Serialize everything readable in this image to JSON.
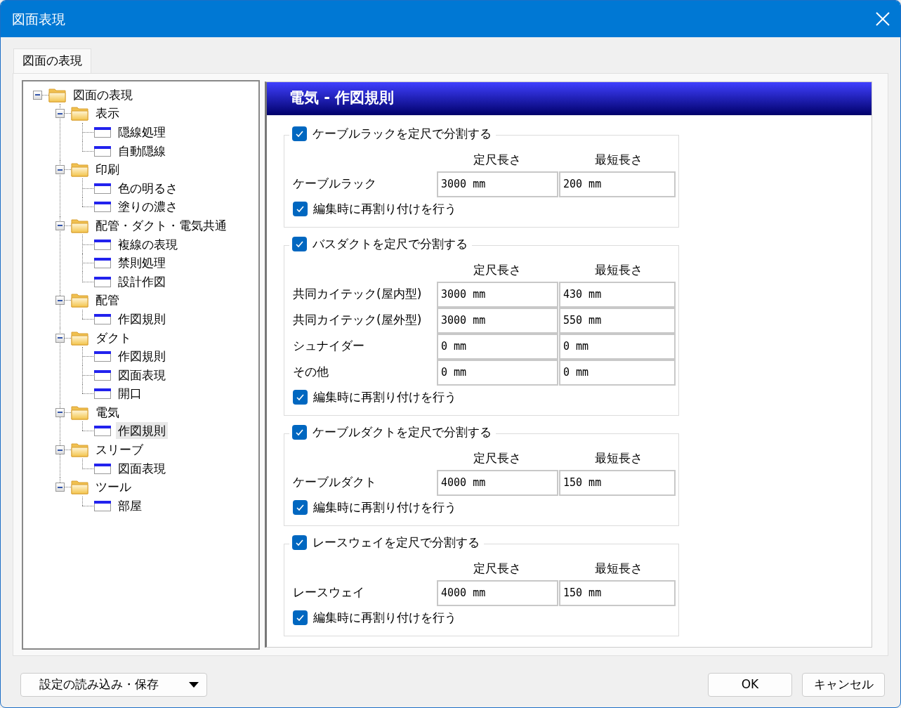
{
  "window": {
    "title": "図面表現"
  },
  "tabs": [
    {
      "label": "図面の表現",
      "selected": true
    }
  ],
  "tree": [
    {
      "label": "図面の表現",
      "kind": "folder",
      "expanded": true,
      "selected": false,
      "children": [
        {
          "label": "表示",
          "kind": "folder",
          "expanded": true,
          "selected": false,
          "children": [
            {
              "label": "隠線処理",
              "kind": "page",
              "selected": false
            },
            {
              "label": "自動隠線",
              "kind": "page",
              "selected": false
            }
          ]
        },
        {
          "label": "印刷",
          "kind": "folder",
          "expanded": true,
          "selected": false,
          "children": [
            {
              "label": "色の明るさ",
              "kind": "page",
              "selected": false
            },
            {
              "label": "塗りの濃さ",
              "kind": "page",
              "selected": false
            }
          ]
        },
        {
          "label": "配管・ダクト・電気共通",
          "kind": "folder",
          "expanded": true,
          "selected": false,
          "children": [
            {
              "label": "複線の表現",
              "kind": "page",
              "selected": false
            },
            {
              "label": "禁則処理",
              "kind": "page",
              "selected": false
            },
            {
              "label": "設計作図",
              "kind": "page",
              "selected": false
            }
          ]
        },
        {
          "label": "配管",
          "kind": "folder",
          "expanded": true,
          "selected": false,
          "children": [
            {
              "label": "作図規則",
              "kind": "page",
              "selected": false
            }
          ]
        },
        {
          "label": "ダクト",
          "kind": "folder",
          "expanded": true,
          "selected": false,
          "children": [
            {
              "label": "作図規則",
              "kind": "page",
              "selected": false
            },
            {
              "label": "図面表現",
              "kind": "page",
              "selected": false
            },
            {
              "label": "開口",
              "kind": "page",
              "selected": false
            }
          ]
        },
        {
          "label": "電気",
          "kind": "folder",
          "expanded": true,
          "selected": false,
          "children": [
            {
              "label": "作図規則",
              "kind": "page",
              "selected": true
            }
          ]
        },
        {
          "label": "スリーブ",
          "kind": "folder",
          "expanded": true,
          "selected": false,
          "children": [
            {
              "label": "図面表現",
              "kind": "page",
              "selected": false
            }
          ]
        },
        {
          "label": "ツール",
          "kind": "folder",
          "expanded": true,
          "selected": false,
          "children": [
            {
              "label": "部屋",
              "kind": "page",
              "selected": false
            }
          ]
        }
      ]
    }
  ],
  "panel": {
    "title": "電気 - 作図規則",
    "groups": [
      {
        "label": "ケーブルラックを定尺で分割する",
        "checked": true,
        "columns": [
          "定尺長さ",
          "最短長さ"
        ],
        "rows": [
          {
            "label": "ケーブルラック",
            "values": [
              "3000 mm",
              "200 mm"
            ]
          }
        ],
        "option": {
          "label": "編集時に再割り付けを行う",
          "checked": true
        }
      },
      {
        "label": "バスダクトを定尺で分割する",
        "checked": true,
        "columns": [
          "定尺長さ",
          "最短長さ"
        ],
        "rows": [
          {
            "label": "共同カイテック(屋内型)",
            "values": [
              "3000 mm",
              "430 mm"
            ]
          },
          {
            "label": "共同カイテック(屋外型)",
            "values": [
              "3000 mm",
              "550 mm"
            ]
          },
          {
            "label": "シュナイダー",
            "values": [
              "0 mm",
              "0 mm"
            ]
          },
          {
            "label": "その他",
            "values": [
              "0 mm",
              "0 mm"
            ]
          }
        ],
        "option": {
          "label": "編集時に再割り付けを行う",
          "checked": true
        }
      },
      {
        "label": "ケーブルダクトを定尺で分割する",
        "checked": true,
        "columns": [
          "定尺長さ",
          "最短長さ"
        ],
        "rows": [
          {
            "label": "ケーブルダクト",
            "values": [
              "4000 mm",
              "150 mm"
            ]
          }
        ],
        "option": {
          "label": "編集時に再割り付けを行う",
          "checked": true
        }
      },
      {
        "label": "レースウェイを定尺で分割する",
        "checked": true,
        "columns": [
          "定尺長さ",
          "最短長さ"
        ],
        "rows": [
          {
            "label": "レースウェイ",
            "values": [
              "4000 mm",
              "150 mm"
            ]
          }
        ],
        "option": {
          "label": "編集時に再割り付けを行う",
          "checked": true
        }
      }
    ]
  },
  "footer": {
    "menu_button": {
      "label": "設定の読み込み・保存"
    },
    "buttons": [
      {
        "label": "OK"
      },
      {
        "label": "キャンセル"
      }
    ]
  }
}
